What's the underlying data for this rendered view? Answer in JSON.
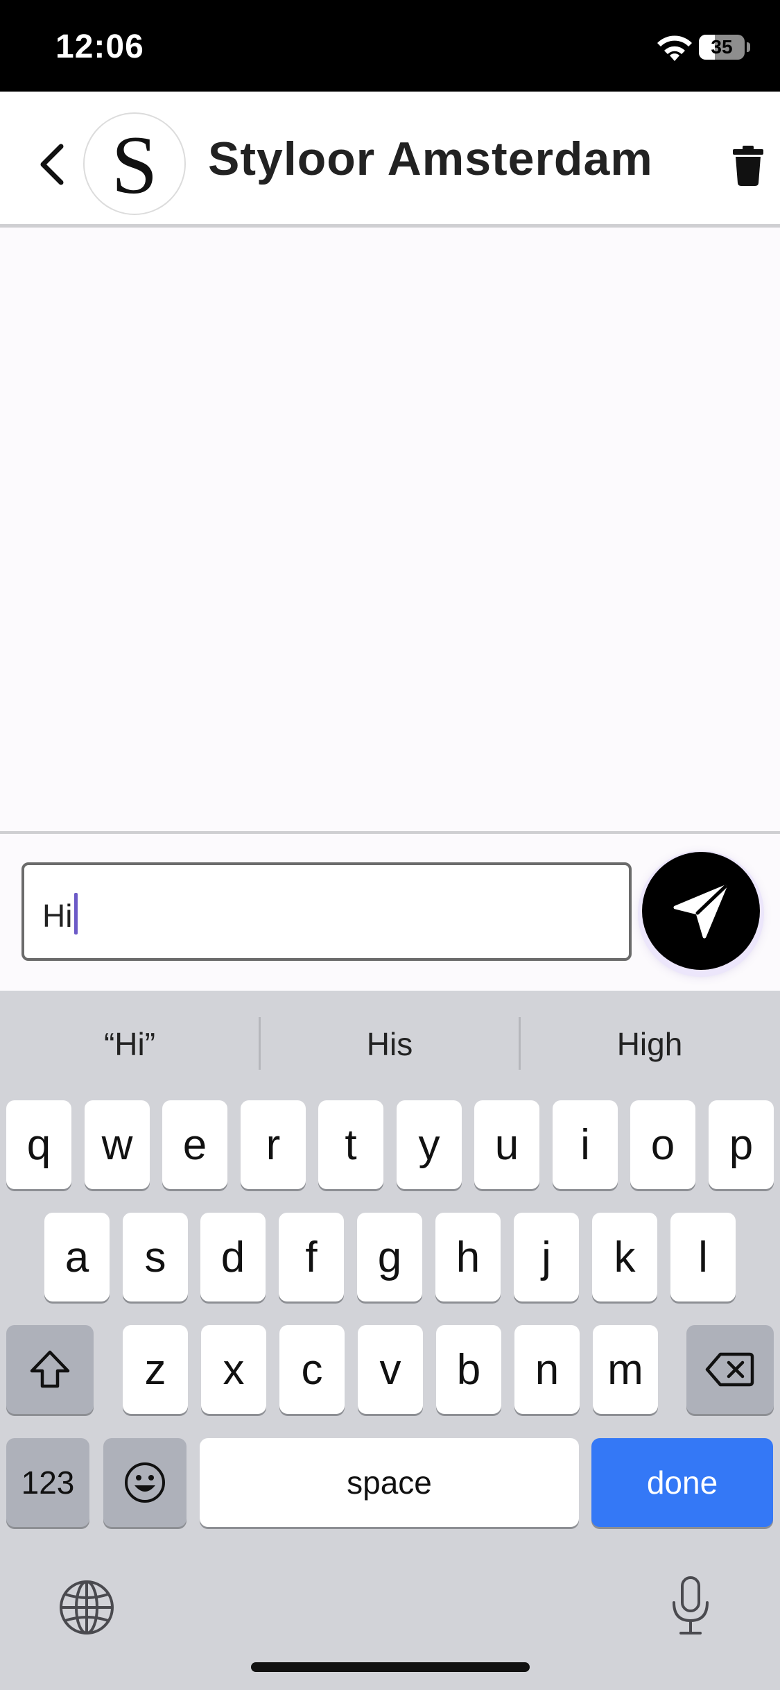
{
  "status_bar": {
    "time": "12:06",
    "battery_level": "35",
    "battery_fraction": 0.35,
    "icons": [
      "wifi-icon",
      "battery-icon"
    ]
  },
  "header": {
    "title": "Styloor Amsterdam",
    "avatar_letter": "S",
    "icons": [
      "chevron-left-icon",
      "trash-icon"
    ]
  },
  "composer": {
    "input_value": "Hi",
    "send_icon": "send-icon"
  },
  "keyboard": {
    "suggestions": [
      "“Hi”",
      "His",
      "High"
    ],
    "row1": [
      "q",
      "w",
      "e",
      "r",
      "t",
      "y",
      "u",
      "i",
      "o",
      "p"
    ],
    "row2": [
      "a",
      "s",
      "d",
      "f",
      "g",
      "h",
      "j",
      "k",
      "l"
    ],
    "row3": [
      "z",
      "x",
      "c",
      "v",
      "b",
      "n",
      "m"
    ],
    "numbers_label": "123",
    "space_label": "space",
    "done_label": "done",
    "accent_color": "#3478f6",
    "icons": [
      "shift-icon",
      "backspace-icon",
      "emoji-icon",
      "globe-icon",
      "microphone-icon"
    ]
  }
}
